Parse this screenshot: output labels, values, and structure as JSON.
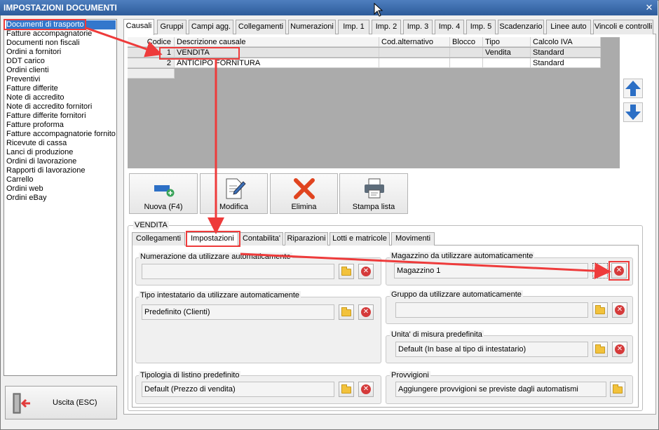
{
  "window": {
    "title": "IMPOSTAZIONI DOCUMENTI"
  },
  "doc_types": [
    "Documenti di trasporto",
    "Fatture accompagnatorie",
    "Documenti non fiscali",
    "Ordini a fornitori",
    "DDT carico",
    "Ordini clienti",
    "Preventivi",
    "Fatture differite",
    "Note di accredito",
    "Note di accredito fornitori",
    "Fatture differite fornitori",
    "Fatture proforma",
    "Fatture accompagnatorie fornito",
    "Ricevute di cassa",
    "Lanci di produzione",
    "Ordini di lavorazione",
    "Rapporti di lavorazione",
    "Carrello",
    "Ordini web",
    "Ordini eBay"
  ],
  "exit_label": "Uscita (ESC)",
  "main_tabs": [
    "Causali",
    "Gruppi",
    "Campi agg.",
    "Collegamenti",
    "Numerazioni",
    "Imp. 1",
    "Imp. 2",
    "Imp. 3",
    "Imp. 4",
    "Imp. 5",
    "Scadenzario",
    "Linee auto",
    "Vincoli e controlli"
  ],
  "grid": {
    "columns": [
      "Codice",
      "Descrizione causale",
      "Cod.alternativo",
      "Blocco",
      "Tipo",
      "Calcolo IVA"
    ],
    "rows": [
      [
        "1",
        "VENDITA",
        "",
        "",
        "Vendita",
        "Standard"
      ],
      [
        "2",
        "ANTICIPO FORNITURA",
        "",
        "",
        "",
        "Standard"
      ]
    ]
  },
  "toolbar": {
    "new_label": "Nuova (F4)",
    "edit_label": "Modifica",
    "delete_label": "Elimina",
    "print_label": "Stampa lista"
  },
  "group_title": "VENDITA",
  "sub_tabs": [
    "Collegamenti",
    "Impostazioni",
    "Contabilita'",
    "Riparazioni",
    "Lotti e matricole",
    "Movimenti"
  ],
  "fields": {
    "numerazione": {
      "label": "Numerazione da utilizzare automaticamente",
      "value": ""
    },
    "tipo_intestatario": {
      "label": "Tipo intestatario da utilizzare automaticamente",
      "value": "Predefinito (Clienti)"
    },
    "listino": {
      "label": "Tipologia di listino predefinito",
      "value": "Default (Prezzo di vendita)"
    },
    "magazzino": {
      "label": "Magazzino da utilizzare automaticamente",
      "value": "Magazzino 1"
    },
    "gruppo": {
      "label": "Gruppo da utilizzare automaticamente",
      "value": ""
    },
    "unita": {
      "label": "Unita' di misura predefinita",
      "value": "Default (In base al tipo di intestatario)"
    },
    "provvigioni": {
      "label": "Provvigioni",
      "value": "Aggiungere provvigioni se previste dagli automatismi"
    }
  },
  "colors": {
    "titlebar": "#2d5b9a",
    "selection": "#3377cc",
    "highlight": "#ee3b3b"
  }
}
